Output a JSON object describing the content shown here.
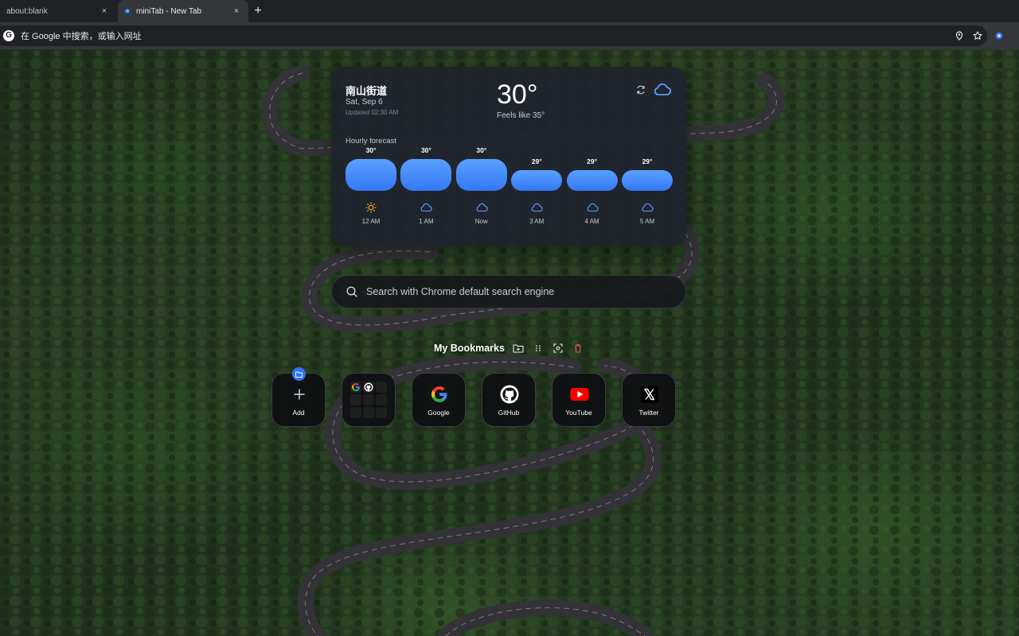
{
  "browser": {
    "tabs": [
      {
        "title": "about:blank",
        "active": false
      },
      {
        "title": "miniTab - New Tab",
        "active": true
      }
    ],
    "new_tab_symbol": "+",
    "close_symbol": "×",
    "omnibox_placeholder": "在 Google 中搜索，或输入网址",
    "omnibox_icons": [
      "location-pin-icon",
      "bookmark-star-icon",
      "extension-icon"
    ]
  },
  "weather": {
    "location": "南山街道",
    "date": "Sat, Sep 6",
    "updated": "Updated 02:30 AM",
    "temperature": "30°",
    "feels_like": "Feels like 35°",
    "condition_icon": "cloud-icon",
    "hourly_label": "Hourly forecast",
    "hourly": [
      {
        "temp": "30°",
        "value": 30,
        "time": "12 AM",
        "icon": "sun-icon"
      },
      {
        "temp": "30°",
        "value": 30,
        "time": "1 AM",
        "icon": "cloud-icon"
      },
      {
        "temp": "30°",
        "value": 30,
        "time": "Now",
        "icon": "cloud-icon"
      },
      {
        "temp": "29°",
        "value": 29,
        "time": "3 AM",
        "icon": "cloud-icon"
      },
      {
        "temp": "29°",
        "value": 29,
        "time": "4 AM",
        "icon": "cloud-icon"
      },
      {
        "temp": "29°",
        "value": 29,
        "time": "5 AM",
        "icon": "cloud-icon"
      }
    ],
    "bar_color": "#3b82f6"
  },
  "search": {
    "placeholder": "Search with Chrome default search engine"
  },
  "bookmarks": {
    "title": "My Bookmarks",
    "tools": [
      "folder-add-icon",
      "drag-grid-icon",
      "screenshot-icon",
      "trash-icon"
    ],
    "tiles": [
      {
        "label": "Add",
        "icon": "plus-icon"
      },
      {
        "label": "",
        "icon": "folder-icon"
      },
      {
        "label": "Google",
        "icon": "google-icon"
      },
      {
        "label": "GitHub",
        "icon": "github-icon"
      },
      {
        "label": "YouTube",
        "icon": "youtube-icon"
      },
      {
        "label": "Twitter",
        "icon": "x-icon"
      }
    ]
  }
}
